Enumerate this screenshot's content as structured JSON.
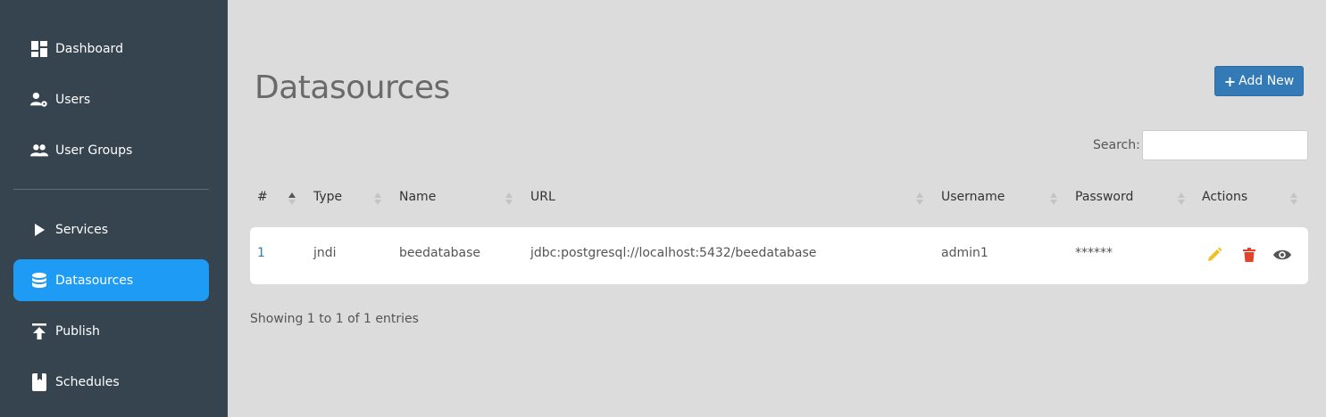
{
  "sidebar": {
    "items": [
      {
        "label": "Dashboard",
        "icon": "dashboard-icon"
      },
      {
        "label": "Users",
        "icon": "user-settings-icon"
      },
      {
        "label": "User Groups",
        "icon": "user-group-icon"
      },
      {
        "label": "Services",
        "icon": "play-icon"
      },
      {
        "label": "Datasources",
        "icon": "database-icon",
        "active": true
      },
      {
        "label": "Publish",
        "icon": "publish-icon"
      },
      {
        "label": "Schedules",
        "icon": "book-icon"
      }
    ]
  },
  "main": {
    "title": "Datasources",
    "add_button_label": "Add New",
    "search_label": "Search:",
    "search_value": "",
    "columns": [
      "#",
      "Type",
      "Name",
      "URL",
      "Username",
      "Password",
      "Actions"
    ],
    "rows": [
      {
        "id": "1",
        "type": "jndi",
        "name": "beedatabase",
        "url": "jdbc:postgresql://localhost:5432/beedatabase",
        "username": "admin1",
        "password": "******"
      }
    ],
    "info": "Showing 1 to 1 of 1 entries"
  },
  "colors": {
    "sidebar_bg": "#36444f",
    "active_item": "#1e9bf5",
    "page_bg": "#dcdcdc",
    "primary_button": "#337ab7",
    "edit_icon": "#f0c020",
    "delete_icon": "#e0442b",
    "view_icon": "#555555"
  }
}
